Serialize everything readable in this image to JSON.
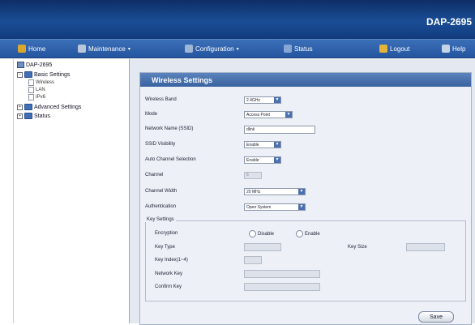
{
  "header": {
    "model": "DAP-2695"
  },
  "menu": [
    {
      "label": "Home",
      "icon": "home-icon",
      "color": "#d9a72b"
    },
    {
      "label": "Maintenance",
      "icon": "wrench-icon",
      "color": "#b9c7dc",
      "caret": "▾"
    },
    {
      "label": "Configuration",
      "icon": "tools-icon",
      "color": "#9fb6d6",
      "caret": "▾"
    },
    {
      "label": "Status",
      "icon": "status-icon",
      "color": "#86a7d3"
    },
    {
      "label": "Logout",
      "icon": "logout-icon",
      "color": "#e2b43a"
    },
    {
      "label": "Help",
      "icon": "help-icon",
      "color": "#c7d3e6"
    }
  ],
  "tree": {
    "root": "DAP-2695",
    "basic": "Basic Settings",
    "children": [
      "Wireless",
      "LAN",
      "IPv6"
    ],
    "advanced": "Advanced Settings",
    "status": "Status"
  },
  "panel": {
    "title": "Wireless Settings",
    "wireless_band": {
      "label": "Wireless Band",
      "value": "2.4GHz"
    },
    "mode": {
      "label": "Mode",
      "value": "Access Point"
    },
    "ssid": {
      "label": "Network Name (SSID)",
      "value": "dlink"
    },
    "ssid_visibility": {
      "label": "SSID Visibility",
      "value": "Enable"
    },
    "auto_channel": {
      "label": "Auto Channel Selection",
      "value": "Enable"
    },
    "channel": {
      "label": "Channel",
      "value": "6"
    },
    "channel_width": {
      "label": "Channel Width",
      "value": "20 MHz"
    },
    "authentication": {
      "label": "Authentication",
      "value": "Open System"
    },
    "key_settings": {
      "legend": "Key Settings",
      "encryption_label": "Encryption",
      "disable": "Disable",
      "enable": "Enable",
      "key_type_label": "Key Type",
      "key_size_label": "Key Size",
      "key_index_label": "Key Index(1~4)",
      "network_key_label": "Network Key",
      "confirm_key_label": "Confirm Key"
    },
    "save": "Save"
  }
}
